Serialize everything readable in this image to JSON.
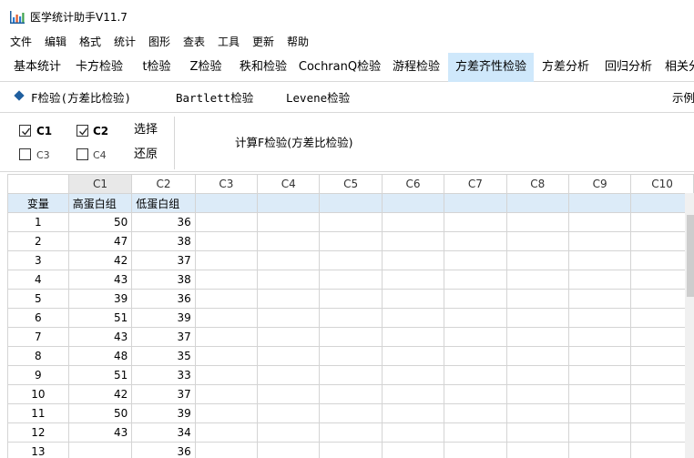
{
  "app": {
    "title": "医学统计助手V11.7"
  },
  "menu": [
    "文件",
    "编辑",
    "格式",
    "统计",
    "图形",
    "查表",
    "工具",
    "更新",
    "帮助"
  ],
  "tabs": [
    "基本统计",
    "卡方检验",
    "t检验",
    "Z检验",
    "秩和检验",
    "CochranQ检验",
    "游程检验",
    "方差齐性检验",
    "方差分析",
    "回归分析",
    "相关分"
  ],
  "active_tab": "方差齐性检验",
  "subtabs": {
    "f_test": "F检验(方差比检验)",
    "bartlett": "Bartlett检验",
    "levene": "Levene检验",
    "example": "示例"
  },
  "options": {
    "c1": {
      "label": "C1",
      "checked": true
    },
    "c2": {
      "label": "C2",
      "checked": true
    },
    "c3": {
      "label": "C3",
      "checked": false
    },
    "c4": {
      "label": "C4",
      "checked": false
    },
    "select": "选择",
    "restore": "还原",
    "calculate": "计算F检验(方差比检验)"
  },
  "grid": {
    "columns": [
      "C1",
      "C2",
      "C3",
      "C4",
      "C5",
      "C6",
      "C7",
      "C8",
      "C9",
      "C10"
    ],
    "var_label": "变量",
    "var_names": [
      "高蛋白组",
      "低蛋白组"
    ],
    "rows": [
      {
        "n": "1",
        "c1": "50",
        "c2": "36"
      },
      {
        "n": "2",
        "c1": "47",
        "c2": "38"
      },
      {
        "n": "3",
        "c1": "42",
        "c2": "37"
      },
      {
        "n": "4",
        "c1": "43",
        "c2": "38"
      },
      {
        "n": "5",
        "c1": "39",
        "c2": "36"
      },
      {
        "n": "6",
        "c1": "51",
        "c2": "39"
      },
      {
        "n": "7",
        "c1": "43",
        "c2": "37"
      },
      {
        "n": "8",
        "c1": "48",
        "c2": "35"
      },
      {
        "n": "9",
        "c1": "51",
        "c2": "33"
      },
      {
        "n": "10",
        "c1": "42",
        "c2": "37"
      },
      {
        "n": "11",
        "c1": "50",
        "c2": "39"
      },
      {
        "n": "12",
        "c1": "43",
        "c2": "34"
      },
      {
        "n": "13",
        "c1": "",
        "c2": "36"
      }
    ]
  },
  "colors": {
    "active_tab": "#cfe8fb",
    "variable_row": "#dcebf8",
    "icon_blue": "#1f5f9f"
  }
}
